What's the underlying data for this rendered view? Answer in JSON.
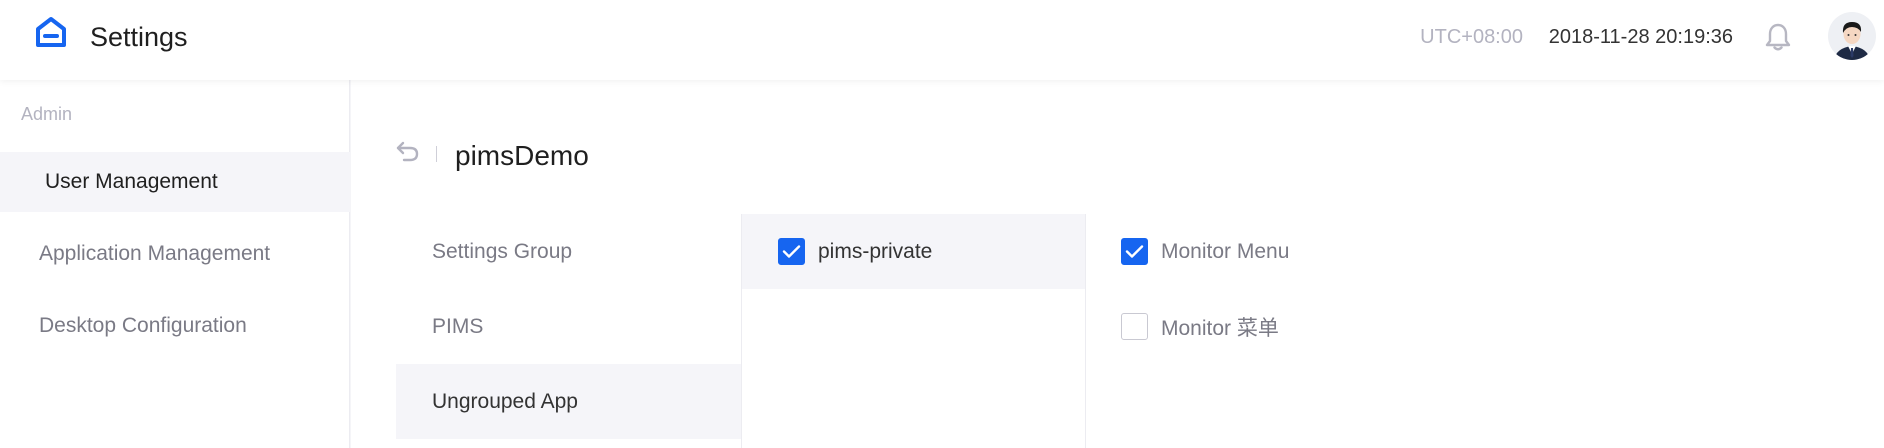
{
  "colors": {
    "accent": "#1665f0",
    "active_bg": "#f5f5f9",
    "muted_text": "#b3b3c0"
  },
  "header": {
    "logo_icon": "home-icon",
    "title": "Settings",
    "timezone": "UTC+08:00",
    "datetime": "2018-11-28 20:19:36",
    "notification_icon": "bell-icon",
    "avatar_icon": "user-avatar"
  },
  "sidebar": {
    "section_label": "Admin",
    "items": [
      {
        "label": "User Management",
        "active": true
      },
      {
        "label": "Application Management",
        "active": false
      },
      {
        "label": "Desktop Configuration",
        "active": false
      }
    ]
  },
  "main": {
    "back_icon": "back-arrow-icon",
    "title": "pimsDemo",
    "groups": [
      {
        "label": "Settings Group",
        "active": false
      },
      {
        "label": "PIMS",
        "active": false
      },
      {
        "label": "Ungrouped App",
        "active": true
      }
    ],
    "apps": [
      {
        "label": "pims-private",
        "checked": true
      }
    ],
    "permissions": [
      {
        "label": "Monitor Menu",
        "checked": true
      },
      {
        "label": "Monitor 菜单",
        "checked": false
      }
    ]
  }
}
